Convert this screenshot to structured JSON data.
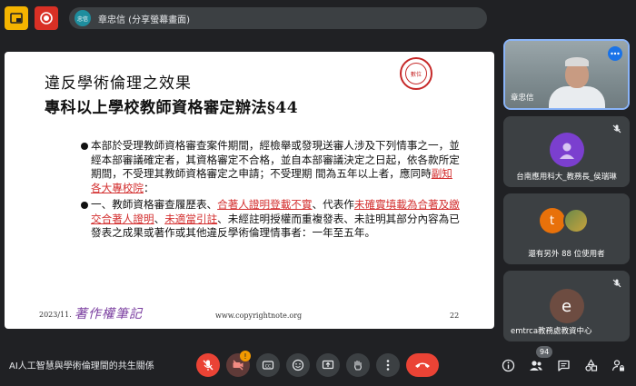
{
  "top_bar": {
    "presenter_avatar_label": "忠信",
    "presenter_text": "章忠信 (分享螢幕畫面)"
  },
  "slide": {
    "seal_text": "數位",
    "title_line1": "違反學術倫理之效果",
    "title_line2": "專科以上學校教師資格審定辦法§44",
    "paragraph1": {
      "text": "本部於受理教師資格審查案件期間，經檢舉或發現送審人涉及下列情事之一，並經本部審議確定者，其資格審定不合格，並自本部審議決定之日起，依各款所定期間，不受理其教師資格審定之申請；不受理期 間為五年以上者，應同時",
      "highlight": "副知各大專校院",
      "end": "："
    },
    "paragraph2": {
      "parts": [
        {
          "text": "一、教師資格審查履歷表、",
          "red": false
        },
        {
          "text": "合著人證明登載不實",
          "red": true
        },
        {
          "text": "、代表作",
          "red": false
        },
        {
          "text": "未確實填載為合著及繳交合著人證明",
          "red": true
        },
        {
          "text": "、",
          "red": false
        },
        {
          "text": "未適當引註",
          "red": true
        },
        {
          "text": "、未經註明授權而重複發表、未註明其部分內容為已發表之成果或著作或其他違反學術倫理情事者：一年至五年。",
          "red": false
        }
      ]
    },
    "footer_date": "2023/11.",
    "footer_logo": "著作權筆記",
    "footer_url": "www.copyrightnote.org",
    "footer_page": "22"
  },
  "participants": [
    {
      "name": "章忠信",
      "type": "video"
    },
    {
      "name": "台南應用科大_教務長_侯瑞琳",
      "type": "avatar",
      "initial": "",
      "color": "#7b3fcf",
      "muted": true
    },
    {
      "name": "還有另外 88 位使用者",
      "type": "group",
      "initial": "t",
      "color": "#e8710a"
    },
    {
      "name": "emtrca教務處教資中心",
      "type": "avatar",
      "initial": "e",
      "color": "#6d4c41",
      "muted": true
    }
  ],
  "bottom_bar": {
    "meeting_title": "AI人工智慧與學術倫理間的共生關係",
    "warning_badge": "!",
    "people_count": "94"
  },
  "colors": {
    "background": "#202124",
    "tile": "#3c4043",
    "danger": "#ea4335",
    "accent": "#1a73e8",
    "slide_red": "#d32f2f"
  }
}
